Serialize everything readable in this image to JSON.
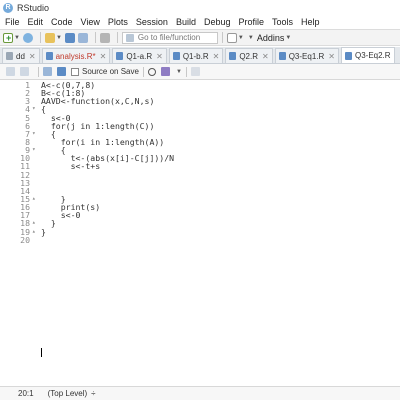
{
  "app": {
    "logo": "R",
    "title": "RStudio"
  },
  "menu": [
    "File",
    "Edit",
    "Code",
    "View",
    "Plots",
    "Session",
    "Build",
    "Debug",
    "Profile",
    "Tools",
    "Help"
  ],
  "toolbar": {
    "goto_placeholder": "Go to file/function",
    "addins_label": "Addins"
  },
  "tabs": [
    {
      "label": "dd",
      "active": false,
      "modified": false
    },
    {
      "label": "analysis.R*",
      "active": false,
      "modified": true
    },
    {
      "label": "Q1-a.R",
      "active": false,
      "modified": false
    },
    {
      "label": "Q1-b.R",
      "active": false,
      "modified": false
    },
    {
      "label": "Q2.R",
      "active": false,
      "modified": false
    },
    {
      "label": "Q3-Eq1.R",
      "active": false,
      "modified": false
    },
    {
      "label": "Q3-Eq2.R",
      "active": true,
      "modified": false
    }
  ],
  "editor_toolbar": {
    "source_on_save": "Source on Save"
  },
  "code_lines": [
    {
      "n": "1",
      "fold": "",
      "text": "A<-c(0,7,8)"
    },
    {
      "n": "2",
      "fold": "",
      "text": "B<-c(1:8)"
    },
    {
      "n": "3",
      "fold": "",
      "text": "AAVD<-function(x,C,N,s)"
    },
    {
      "n": "4",
      "fold": "▾",
      "text": "{"
    },
    {
      "n": "5",
      "fold": "",
      "text": "  s<-0"
    },
    {
      "n": "6",
      "fold": "",
      "text": "  for(j in 1:length(C))"
    },
    {
      "n": "7",
      "fold": "▾",
      "text": "  {"
    },
    {
      "n": "8",
      "fold": "",
      "text": "    for(i in 1:length(A))"
    },
    {
      "n": "9",
      "fold": "▾",
      "text": "    {"
    },
    {
      "n": "10",
      "fold": "",
      "text": "      t<-(abs(x[i]-C[j]))/N"
    },
    {
      "n": "11",
      "fold": "",
      "text": "      s<-t+s"
    },
    {
      "n": "12",
      "fold": "",
      "text": ""
    },
    {
      "n": "13",
      "fold": "",
      "text": ""
    },
    {
      "n": "14",
      "fold": "",
      "text": ""
    },
    {
      "n": "15",
      "fold": "▴",
      "text": "    }"
    },
    {
      "n": "16",
      "fold": "",
      "text": "    print(s)"
    },
    {
      "n": "17",
      "fold": "",
      "text": "    s<-0"
    },
    {
      "n": "18",
      "fold": "▴",
      "text": "  }"
    },
    {
      "n": "19",
      "fold": "▴",
      "text": "}"
    },
    {
      "n": "20",
      "fold": "",
      "text": ""
    }
  ],
  "status": {
    "cursor": "20:1",
    "scope": "(Top Level)",
    "scope_caret": "÷"
  }
}
